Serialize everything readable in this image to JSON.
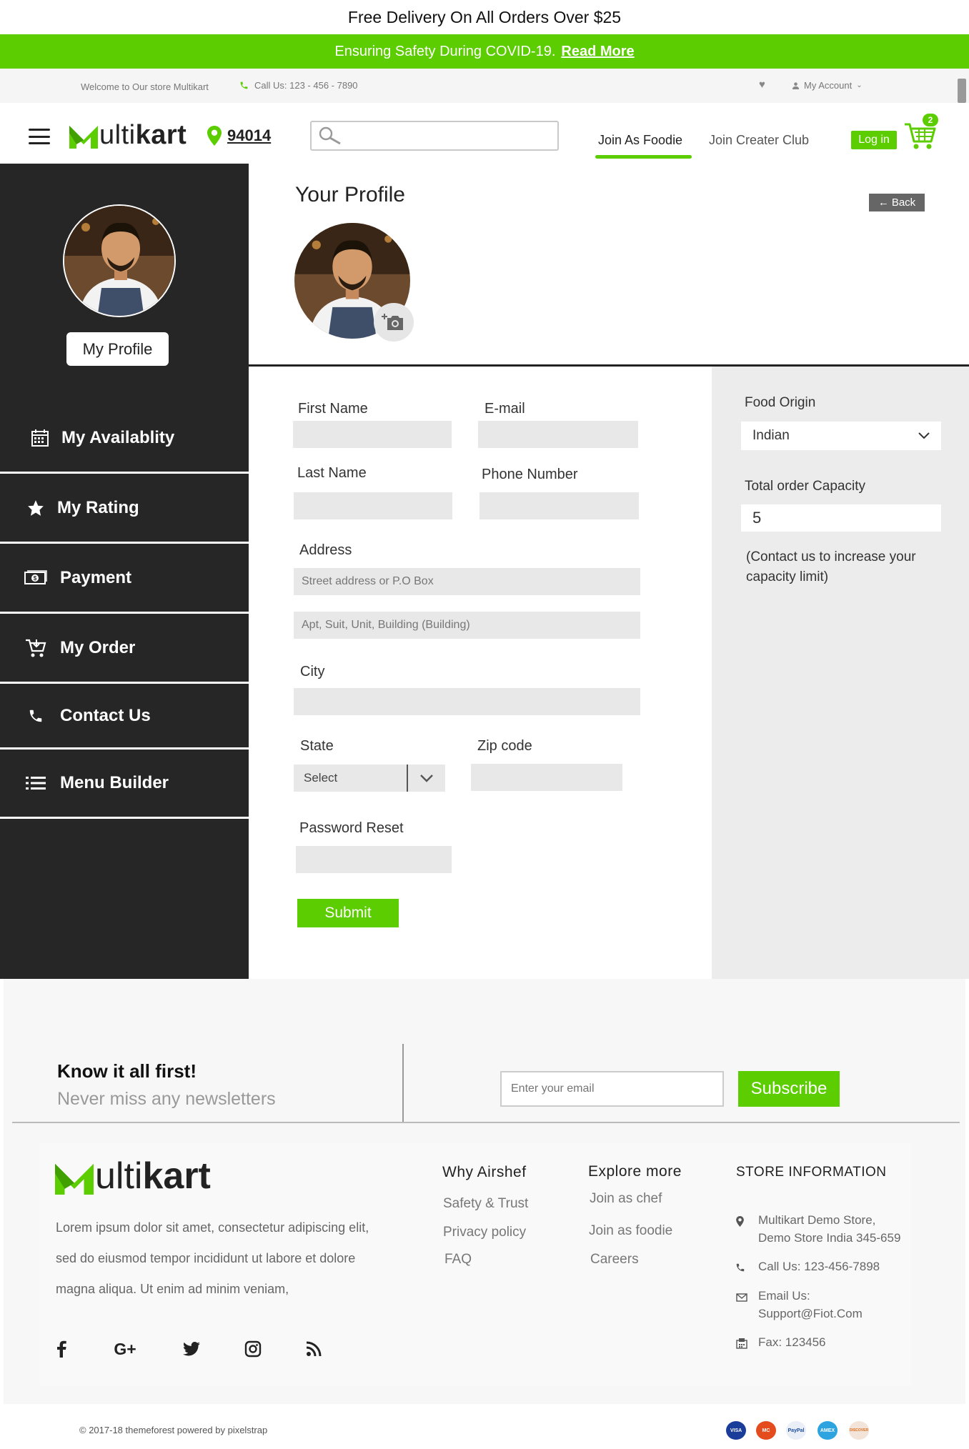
{
  "promo": {
    "text": "Free Delivery On All Orders Over $25"
  },
  "covid": {
    "text": "Ensuring Safety During COVID-19.",
    "link": "Read More"
  },
  "topbar": {
    "welcome": "Welcome to Our store Multikart",
    "call": "Call Us: 123 - 456 - 7890",
    "account": "My Account"
  },
  "header": {
    "logo_prefix": "ulti",
    "logo_bold": "kart",
    "zip": "94014",
    "search_placeholder": "",
    "nav": {
      "foodie": "Join As Foodie",
      "creater": "Join Creater Club"
    },
    "login": "Log in",
    "cart_count": "2"
  },
  "sidebar": {
    "profile_button": "My Profile",
    "items": [
      {
        "label": "My Availablity",
        "icon": "calendar-icon"
      },
      {
        "label": "My Rating",
        "icon": "star-icon"
      },
      {
        "label": "Payment",
        "icon": "money-icon"
      },
      {
        "label": "My Order",
        "icon": "cart-icon"
      },
      {
        "label": "Contact Us",
        "icon": "phone-icon"
      },
      {
        "label": "Menu Builder",
        "icon": "list-icon"
      }
    ]
  },
  "profile": {
    "title": "Your Profile",
    "back": "Back"
  },
  "form": {
    "first_name": "First Name",
    "email": "E-mail",
    "last_name": "Last Name",
    "phone": "Phone Number",
    "address": "Address",
    "address1_placeholder": "Street address or P.O Box",
    "address2_placeholder": "Apt, Suit, Unit, Building (Building)",
    "city": "City",
    "state": "State",
    "state_value": "Select",
    "zip": "Zip code",
    "password": "Password Reset",
    "submit": "Submit"
  },
  "right": {
    "origin_label": "Food Origin",
    "origin_value": "Indian",
    "capacity_label": "Total order Capacity",
    "capacity_value": "5",
    "note": "(Contact us to increase your capacity limit)"
  },
  "newsletter": {
    "title": "Know it all first!",
    "subtitle": "Never miss any newsletters",
    "placeholder": "Enter your email",
    "button": "Subscribe"
  },
  "footer": {
    "logo_prefix": "ulti",
    "logo_bold": "kart",
    "description": "Lorem ipsum dolor sit amet, consectetur adipiscing elit, sed do eiusmod tempor incididunt ut labore et dolore magna aliqua. Ut enim ad minim veniam,",
    "why": {
      "title": "Why Airshef",
      "links": [
        "Safety & Trust",
        "Privacy policy",
        "FAQ"
      ]
    },
    "explore": {
      "title": "Explore more",
      "links": [
        "Join as chef",
        "Join as foodie",
        "Careers"
      ]
    },
    "store": {
      "title": "STORE INFORMATION",
      "address1": "Multikart Demo Store,",
      "address2": "Demo Store India 345-659",
      "call": "Call Us: 123-456-7898",
      "email_label": "Email Us:",
      "email": "Support@Fiot.Com",
      "fax": "Fax: 123456"
    },
    "copyright": "© 2017-18 themeforest powered by pixelstrap",
    "payments": [
      "VISA",
      "MC",
      "PayPal",
      "AMEX",
      "DISCOVER"
    ]
  },
  "colors": {
    "accent": "#5bcd00",
    "sidebar": "#262626",
    "panel": "#ececec"
  }
}
